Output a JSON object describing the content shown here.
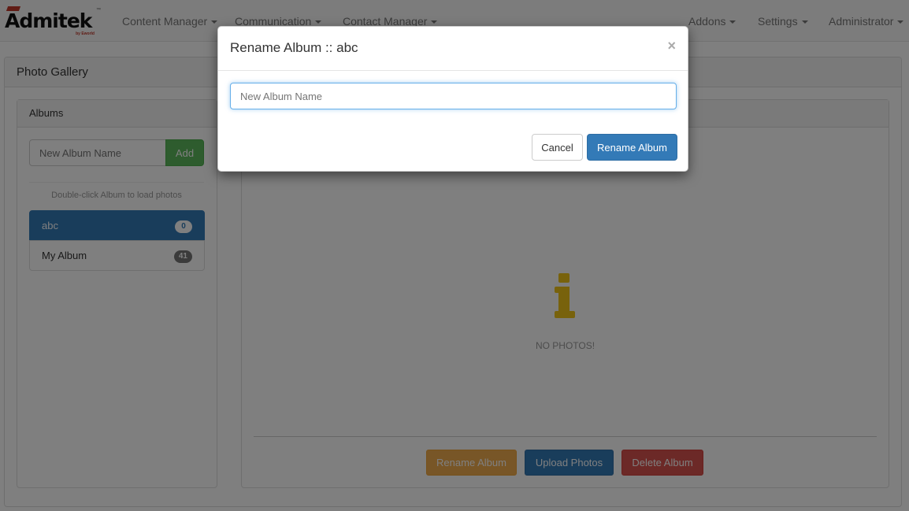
{
  "brand": {
    "name": "Admitek",
    "tagline": "by Eworld",
    "trademark": "™"
  },
  "nav": {
    "left": [
      "Content Manager",
      "Communication",
      "Contact Manager"
    ],
    "right": [
      "Addons",
      "Settings",
      "Administrator"
    ]
  },
  "page": {
    "title": "Photo Gallery"
  },
  "albums": {
    "title": "Albums",
    "input_placeholder": "New Album Name",
    "add_label": "Add",
    "hint": "Double-click Album to load photos",
    "items": [
      {
        "name": "abc",
        "count": "0",
        "active": true
      },
      {
        "name": "My Album",
        "count": "41",
        "active": false
      }
    ]
  },
  "photos": {
    "empty_text": "NO PHOTOS!",
    "icon": "info-icon",
    "rename_label": "Rename Album",
    "upload_label": "Upload Photos",
    "delete_label": "Delete Album"
  },
  "modal": {
    "title": "Rename Album :: abc",
    "close_symbol": "×",
    "input_placeholder": "New Album Name",
    "cancel_label": "Cancel",
    "confirm_label": "Rename Album"
  },
  "colors": {
    "primary": "#337ab7",
    "success": "#5cb85c",
    "warning": "#f0ad4e",
    "danger": "#d9534f",
    "info_icon": "#f0c419"
  }
}
